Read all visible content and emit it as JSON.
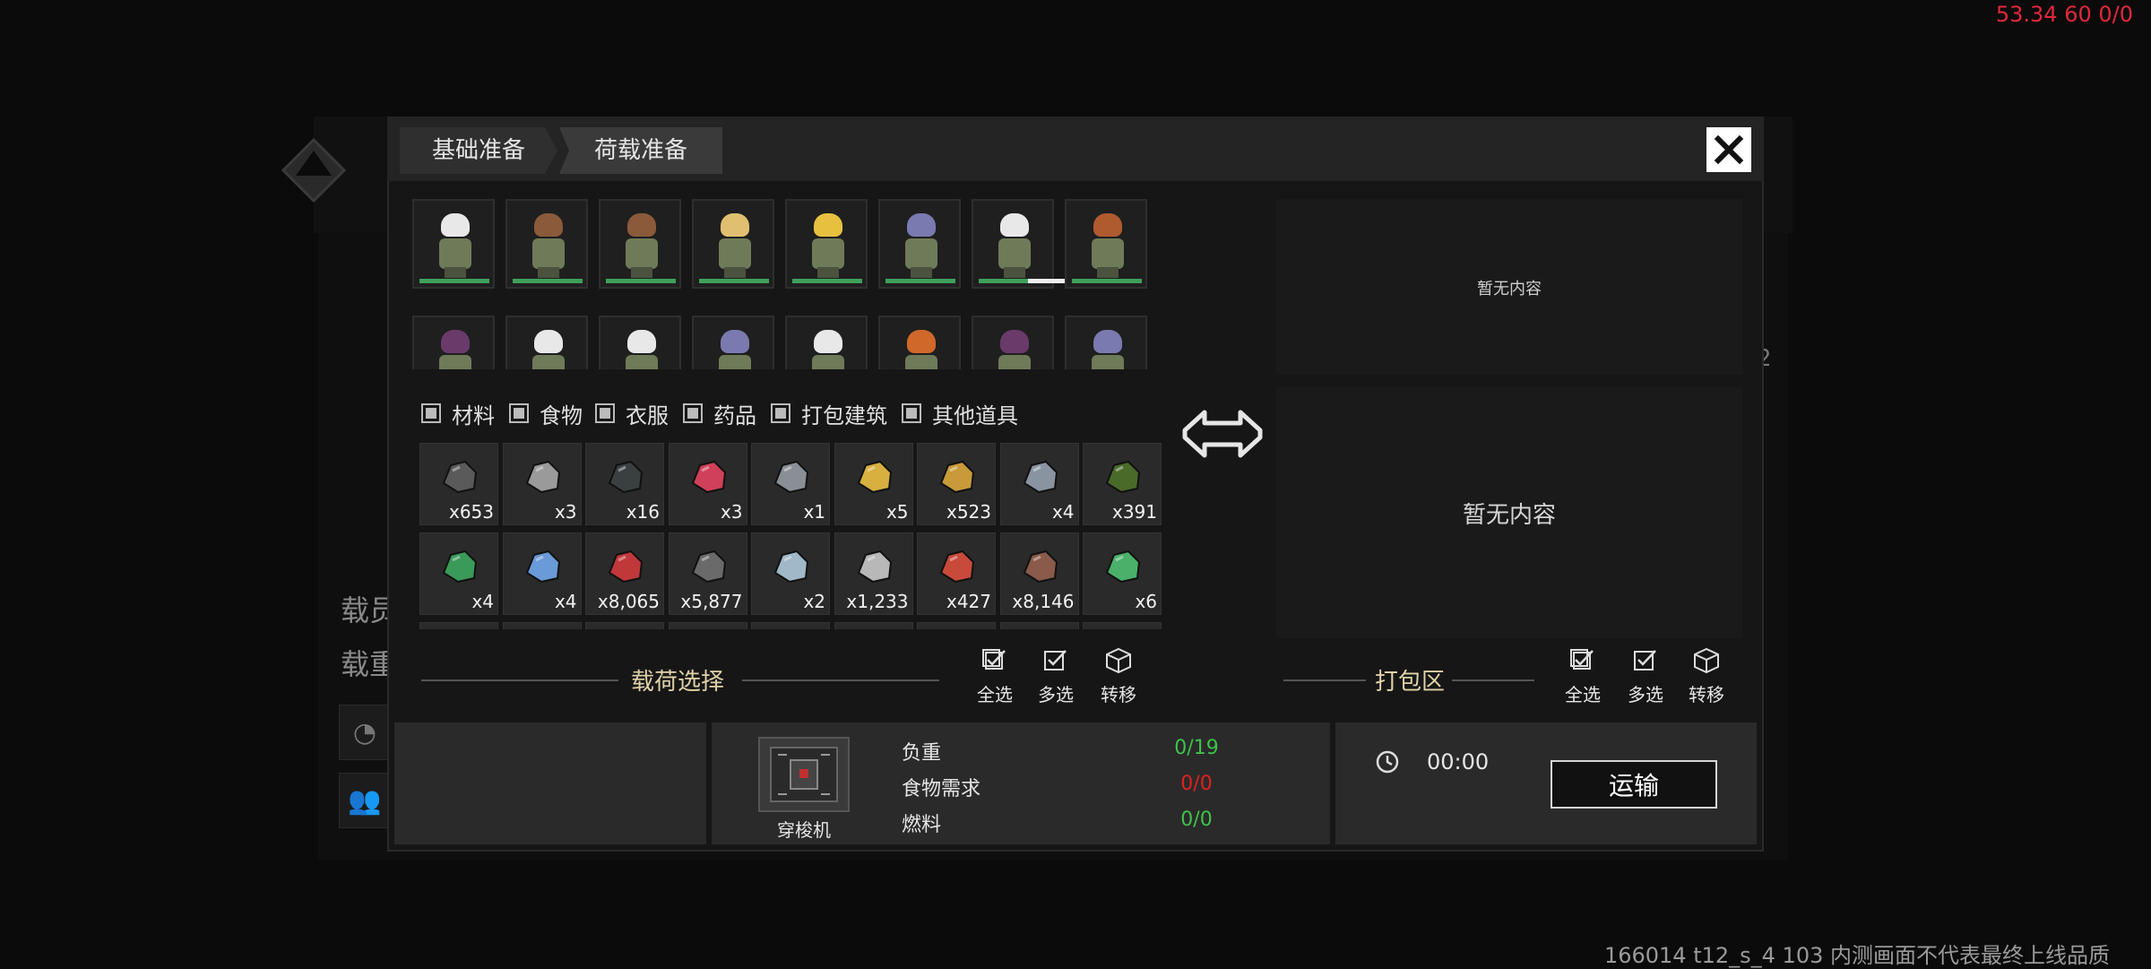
{
  "hud": {
    "fps": "53.34 60 0/0",
    "build": "166014 t12_s_4 103  内测画面不代表最终上线品质"
  },
  "background": {
    "side_label_1": "载员",
    "side_label_2": "载重",
    "side_number": "2"
  },
  "tabs": [
    {
      "label": "基础准备"
    },
    {
      "label": "荷载准备"
    }
  ],
  "crew": [
    {
      "hair": "#e8e8e8",
      "hp": 1.0
    },
    {
      "hair": "#8a5a3a",
      "hp": 1.0
    },
    {
      "hair": "#8a5a3a",
      "hp": 1.0
    },
    {
      "hair": "#e0c070",
      "hp": 1.0
    },
    {
      "hair": "#e8c040",
      "hp": 1.0
    },
    {
      "hair": "#7a7ab0",
      "hp": 1.0
    },
    {
      "hair": "#e8e8e8",
      "hp": 0.7
    },
    {
      "hair": "#b05a30",
      "hp": 1.0
    },
    {
      "hair": "#6a3a6a",
      "hp": 1.0
    },
    {
      "hair": "#e8e8e8",
      "hp": 1.0
    },
    {
      "hair": "#e8e8e8",
      "hp": 1.0
    },
    {
      "hair": "#7a7ab0",
      "hp": 1.0
    },
    {
      "hair": "#e8e8e8",
      "hp": 1.0
    },
    {
      "hair": "#d0682a",
      "hp": 1.0
    },
    {
      "hair": "#6a3a6a",
      "hp": 1.0
    },
    {
      "hair": "#7a7ab0",
      "hp": 1.0
    }
  ],
  "filters": [
    {
      "label": "材料"
    },
    {
      "label": "食物"
    },
    {
      "label": "衣服"
    },
    {
      "label": "药品"
    },
    {
      "label": "打包建筑"
    },
    {
      "label": "其他道具"
    }
  ],
  "items": [
    {
      "icon": "coal-ore-icon",
      "color": "#5a5a5a",
      "count": "x653"
    },
    {
      "icon": "stone-pile-icon",
      "color": "#9a9a9a",
      "count": "x3"
    },
    {
      "icon": "dark-rock-icon",
      "color": "#3a4040",
      "count": "x16"
    },
    {
      "icon": "red-meat-icon",
      "color": "#d0405a",
      "count": "x3"
    },
    {
      "icon": "device-icon",
      "color": "#8a8f96",
      "count": "x1"
    },
    {
      "icon": "gold-crystal-icon",
      "color": "#d8b040",
      "count": "x5"
    },
    {
      "icon": "gold-ore-icon",
      "color": "#c89a3a",
      "count": "x523"
    },
    {
      "icon": "metal-barrel-icon",
      "color": "#8a94a0",
      "count": "x4"
    },
    {
      "icon": "moss-rock-icon",
      "color": "#4a6a2a",
      "count": "x391"
    },
    {
      "icon": "green-gel-icon",
      "color": "#3a9a5a",
      "count": "x4"
    },
    {
      "icon": "blue-crystal-icon",
      "color": "#6a9ad8",
      "count": "x4"
    },
    {
      "icon": "red-container-icon",
      "color": "#c0383a",
      "count": "x8,065"
    },
    {
      "icon": "grey-ore-icon",
      "color": "#6a6a6a",
      "count": "x5,877"
    },
    {
      "icon": "canister-icon",
      "color": "#a0b8c8",
      "count": "x2"
    },
    {
      "icon": "bone-icon",
      "color": "#b8b8b8",
      "count": "x1,233"
    },
    {
      "icon": "starfish-icon",
      "color": "#c84a3a",
      "count": "x427"
    },
    {
      "icon": "brown-ore-icon",
      "color": "#8a5a4a",
      "count": "x8,146"
    },
    {
      "icon": "green-herb-icon",
      "color": "#4ab06a",
      "count": "x6"
    }
  ],
  "zones": {
    "empty_top": "暂无内容",
    "empty_bottom": "暂无内容"
  },
  "load_section": {
    "title": "载荷选择",
    "select_all": "全选",
    "multi_select": "多选",
    "transfer": "转移"
  },
  "pack_section": {
    "title": "打包区",
    "select_all": "全选",
    "multi_select": "多选",
    "transfer": "转移"
  },
  "vehicle": {
    "name": "穿梭机"
  },
  "stats": [
    {
      "label": "负重",
      "value": "0/19",
      "color": "#3ec24a"
    },
    {
      "label": "食物需求",
      "value": "0/0",
      "color": "#e02020"
    },
    {
      "label": "燃料",
      "value": "0/0",
      "color": "#3ec24a"
    }
  ],
  "timer": {
    "value": "00:00"
  },
  "transport_button": {
    "label": "运输"
  }
}
